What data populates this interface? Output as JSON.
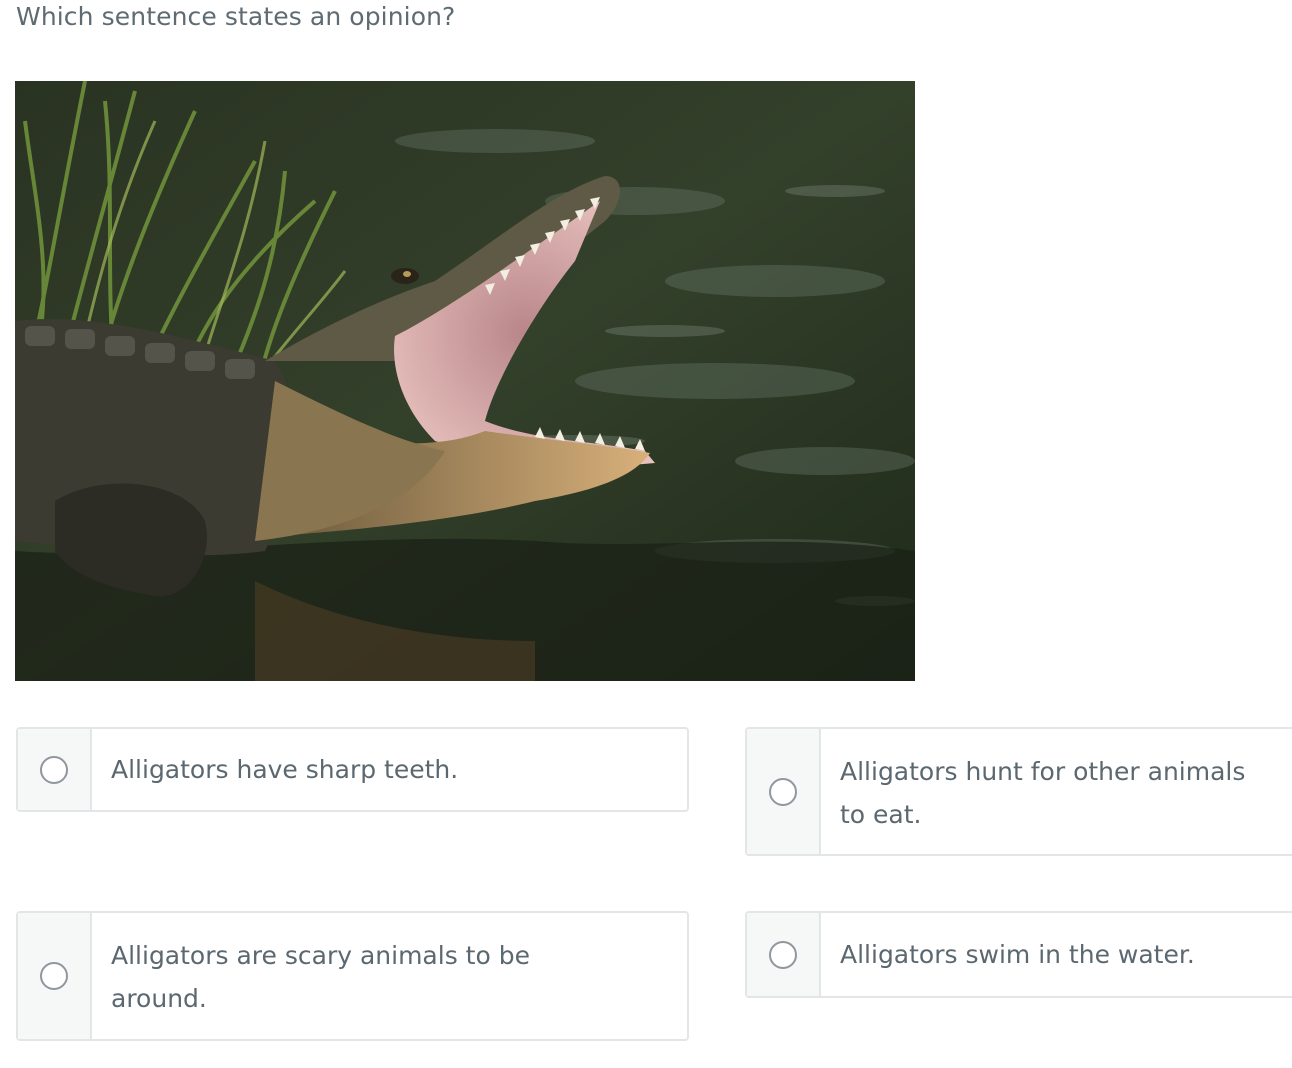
{
  "question": {
    "prompt": "Which sentence states an opinion?"
  },
  "image": {
    "subject_icon": "alligator-photo"
  },
  "choices": [
    {
      "id": "a",
      "text": "Alligators have sharp teeth."
    },
    {
      "id": "b",
      "text": "Alligators hunt for other animals to eat."
    },
    {
      "id": "c",
      "text": "Alligators are scary animals to be around."
    },
    {
      "id": "d",
      "text": "Alligators swim in the water."
    }
  ],
  "colors": {
    "text": "#5c6870",
    "border": "#e3e6e8",
    "radio_cell_bg": "#f6f7f7",
    "radio_ring": "#8f989e"
  }
}
